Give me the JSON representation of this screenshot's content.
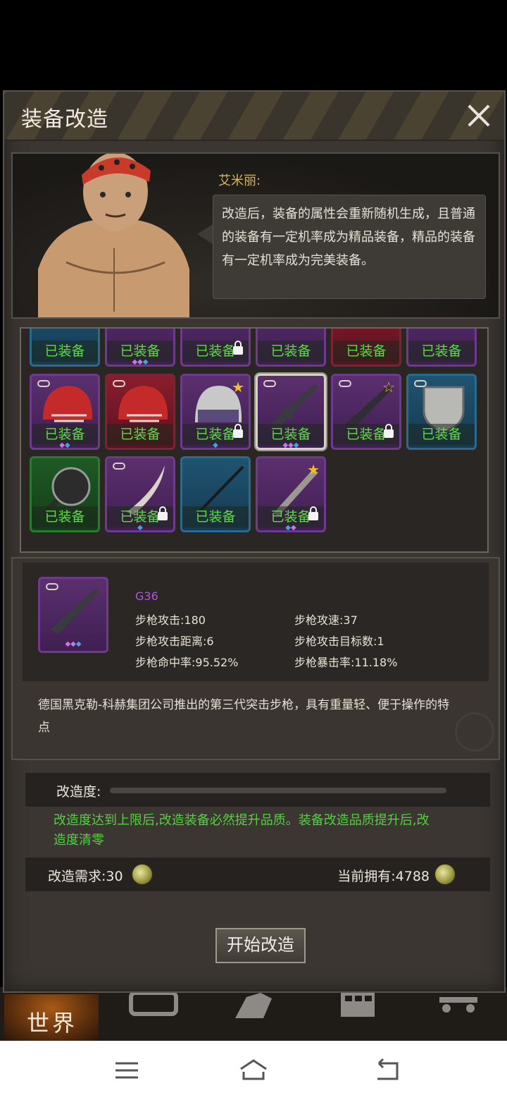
{
  "panel": {
    "title": "装备改造"
  },
  "npc": {
    "name": "艾米丽:",
    "dialog": "改造后，装备的属性会重新随机生成，且普通的装备有一定机率成为精品装备，精品的装备有一定机率成为完美装备。"
  },
  "inventory": {
    "equipped_label": "已装备",
    "top_row": [
      "已装备",
      "已装备",
      "已装备",
      "已装备",
      "已装备",
      "已装备"
    ],
    "row2": [
      "已装备",
      "已装备",
      "已装备",
      "已装备",
      "已装备",
      "已装备"
    ],
    "row3": [
      "已装备",
      "已装备",
      "已装备",
      "已装备"
    ]
  },
  "detail": {
    "name": "G36",
    "stats": {
      "attack": "步枪攻击:180",
      "speed": "步枪攻速:37",
      "range": "步枪攻击距离:6",
      "targets": "步枪攻击目标数:1",
      "accuracy": "步枪命中率:95.52%",
      "crit": "步枪暴击率:11.18%"
    },
    "description": "德国黑克勒-科赫集团公司推出的第三代突击步枪，具有重量轻、便于操作的特点"
  },
  "reform": {
    "progress_label": "改造度:",
    "progress_fraction": 0,
    "notice": "改造度达到上限后,改造装备必然提升品质。装备改造品质提升后,改造度清零",
    "cost_label": "改造需求:30",
    "own_label": "当前拥有:4788",
    "start_button": "开始改造"
  },
  "game_nav": {
    "world": "世界"
  },
  "colors": {
    "equipped": "#62d84a",
    "notice": "#52d23e",
    "npc_name": "#d9b35c",
    "item_name": "#b057d8"
  }
}
